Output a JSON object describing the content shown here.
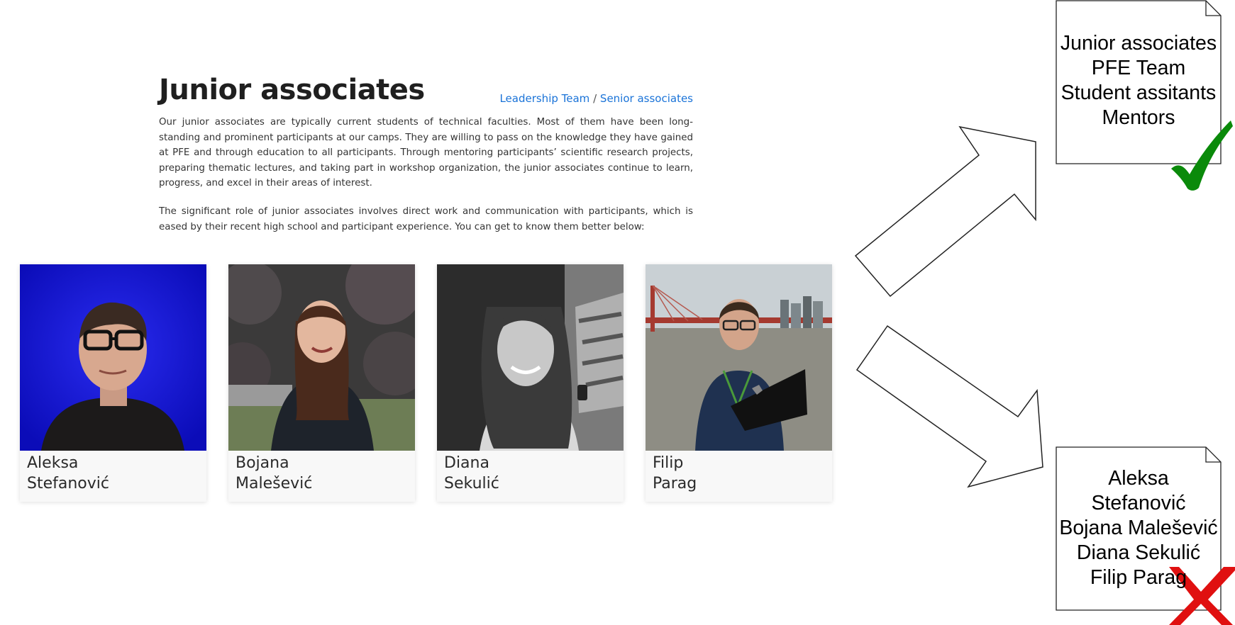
{
  "page": {
    "title": "Junior associates",
    "breadcrumb": {
      "link1": "Leadership Team",
      "separator": "/",
      "link2": "Senior associates"
    },
    "paragraphs": [
      "Our junior associates are typically current students of technical faculties. Most of them have been long-standing and prominent participants at our camps. They are willing to pass on the knowledge they have gained at PFE and through education to all participants. Through mentoring participants’ scientific research projects, preparing thematic lectures, and taking part in workshop organization, the junior associates continue to learn, progress, and excel in their areas of interest.",
      "The significant role of junior associates involves direct work and communication with participants, which is eased by their recent high school and participant experience. You can get to know them better below:"
    ],
    "cards": [
      {
        "first": "Aleksa",
        "last": "Stefanović",
        "photo": "portrait-blue-background"
      },
      {
        "first": "Bojana",
        "last": "Malešević",
        "photo": "portrait-outdoor-leaves"
      },
      {
        "first": "Diana",
        "last": "Sekulić",
        "photo": "portrait-black-and-white"
      },
      {
        "first": "Filip",
        "last": "Parag",
        "photo": "portrait-laptop-bridge"
      }
    ]
  },
  "annotations": {
    "doc_top": {
      "lines": [
        "Junior associates",
        "PFE Team",
        "Student assitants",
        "Mentors"
      ],
      "mark": "green-checkmark-icon"
    },
    "doc_bottom": {
      "lines": [
        "Aleksa",
        "Stefanović",
        "Bojana Malešević",
        "Diana  Sekulić",
        "Filip Parag"
      ],
      "mark": "red-x-icon"
    },
    "colors": {
      "link": "#1a73d8",
      "check": "#0a8a0a",
      "cross": "#e01010"
    }
  }
}
